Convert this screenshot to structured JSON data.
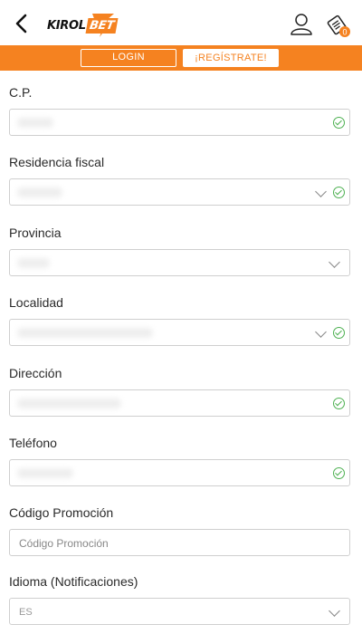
{
  "header": {
    "logo_kirol": "KIROL",
    "logo_bet": "BET",
    "back_icon": "chevron-left-icon",
    "user_icon": "user-icon",
    "coupon_icon": "betslip-icon",
    "coupon_count": "0"
  },
  "auth": {
    "login_label": "LOGIN",
    "register_label": "¡REGÍSTRATE!"
  },
  "colors": {
    "brand_orange": "#f58220",
    "valid_green": "#4cb050"
  },
  "form": {
    "cp": {
      "label": "C.P.",
      "valid": true
    },
    "residencia": {
      "label": "Residencia fiscal",
      "valid": true,
      "type": "select"
    },
    "provincia": {
      "label": "Provincia",
      "valid": false,
      "type": "select"
    },
    "localidad": {
      "label": "Localidad",
      "valid": true,
      "type": "select"
    },
    "direccion": {
      "label": "Dirección",
      "valid": true
    },
    "telefono": {
      "label": "Teléfono",
      "valid": true
    },
    "promo": {
      "label": "Código Promoción",
      "placeholder": "Código Promoción"
    },
    "idioma": {
      "label": "Idioma (Notificaciones)",
      "value": "ES",
      "type": "select"
    }
  }
}
